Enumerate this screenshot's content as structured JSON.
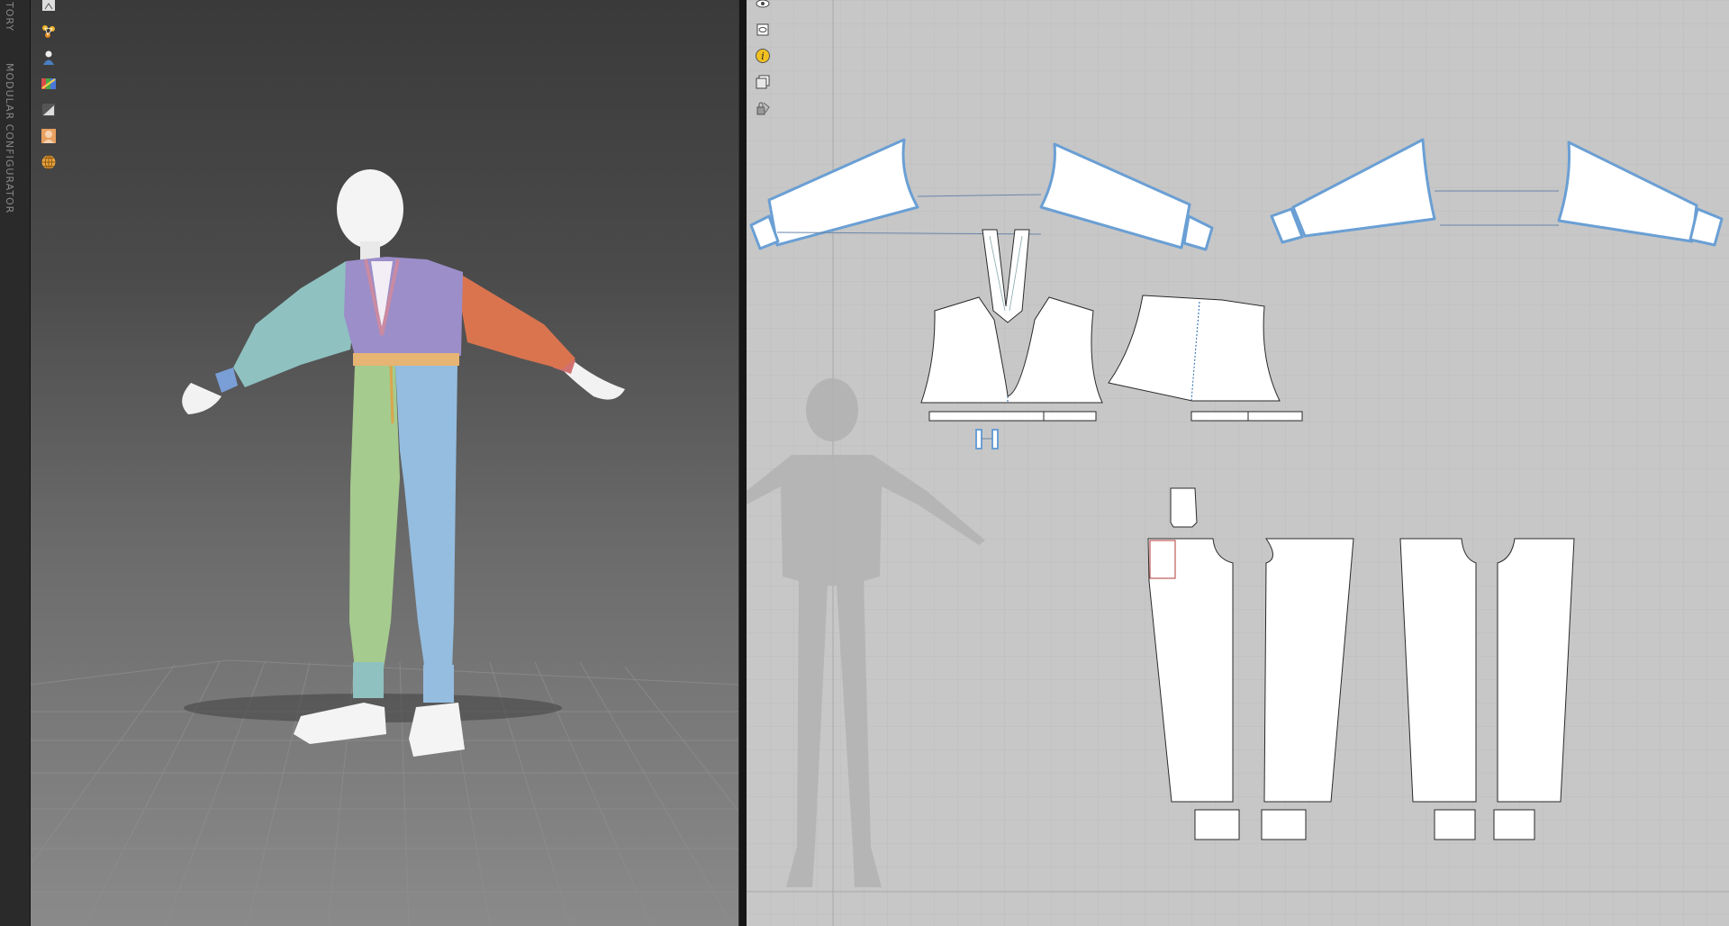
{
  "left_tabs": [
    "TORY",
    "MODULAR CONFIGURATOR"
  ],
  "toolbar_3d": {
    "icons": [
      "avatar-pose-icon",
      "polygon-nodes-icon",
      "avatar-icon",
      "fabric-color-icon",
      "display-mode-icon",
      "skin-avatar-icon",
      "globe-texture-icon"
    ]
  },
  "toolbar_2d": {
    "icons": [
      "show-avatar-icon",
      "show-pattern-icon",
      "info-icon",
      "pattern-layer-icon",
      "lock-pattern-icon"
    ]
  },
  "colors": {
    "pattern_fill": "#ffffff",
    "pattern_selected_outline": "#6a9fd4",
    "grid_2d": "#bcbcbc",
    "panel_purple": "#9b8ec9",
    "panel_orange": "#d9744f",
    "panel_teal": "#8fc1c0",
    "panel_green": "#a6cb8e",
    "panel_blue": "#94bde0"
  }
}
